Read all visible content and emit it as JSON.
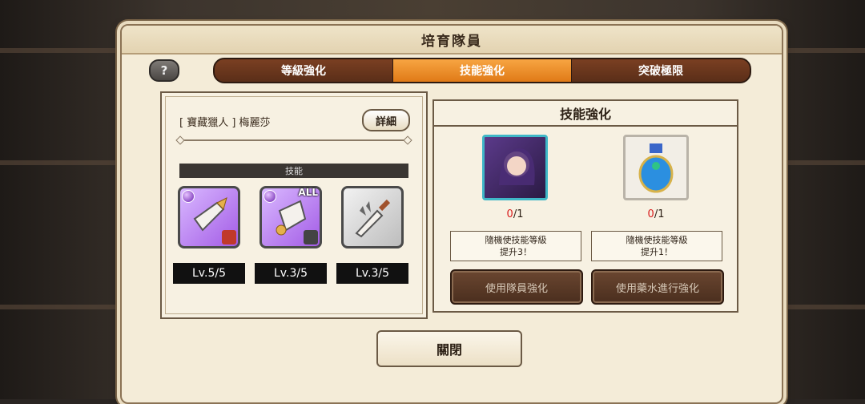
{
  "window": {
    "title": "培育隊員"
  },
  "help": {
    "label": "?"
  },
  "tabs": [
    {
      "label": "等級強化",
      "active": false
    },
    {
      "label": "技能強化",
      "active": true
    },
    {
      "label": "突破極限",
      "active": false
    }
  ],
  "character": {
    "name": "[ 寶藏獵人 ] 梅麗莎",
    "detail_label": "詳細"
  },
  "skills": {
    "header": "技能",
    "items": [
      {
        "icon": "purple-sword-skill-icon",
        "level": "Lv.5/5"
      },
      {
        "icon": "purple-shield-skill-icon",
        "tag": "ALL",
        "level": "Lv.3/5"
      },
      {
        "icon": "grey-dagger-skill-icon",
        "level": "Lv.3/5"
      }
    ]
  },
  "enhance": {
    "title": "技能強化",
    "options": [
      {
        "icon": "character-portrait",
        "count_have": "0",
        "count_need": "/1",
        "desc_line1": "隨機使技能等級",
        "desc_line2": "提升3！",
        "button": "使用隊員強化"
      },
      {
        "icon": "potion-icon",
        "count_have": "0",
        "count_need": "/1",
        "desc_line1": "隨機使技能等級",
        "desc_line2": "提升1！",
        "button": "使用藥水進行強化"
      }
    ]
  },
  "close_label": "關閉",
  "nav": {
    "prev": "‹",
    "next": "›"
  },
  "colors": {
    "accent_tab": "#e07a17",
    "count_red": "#d81b1b",
    "arrow": "#e3339a"
  }
}
